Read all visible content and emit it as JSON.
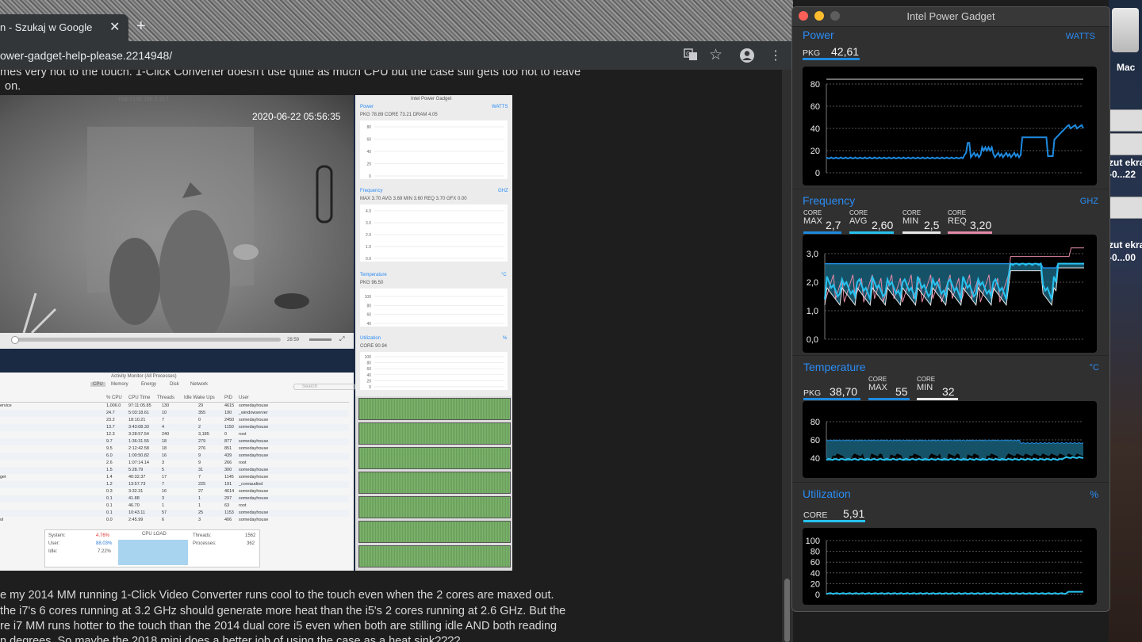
{
  "browser": {
    "tab_title": "n - Szukaj w Google",
    "tab_close": "✕",
    "new_tab": "+",
    "url": "ower-gadget-help-please.2214948/"
  },
  "page": {
    "lines_top": [
      "mes very hot to the touch. 1-Click Converter doesn't use quite as much CPU but the case still gets too hot to leave",
      "on."
    ],
    "lines_bottom": [
      "e my 2014 MM running 1-Click Video Converter runs cool to the touch even when the 2 cores are maxed out.",
      "the i7's 6 cores running at 3.2 GHz should generate more heat than the i5's 2 cores running at 2.6 GHz. But the",
      "re i7 MM runs hotter to the touch than the 2014 dual core i5 even when both are stilling idle AND both reading",
      "n degrees. So maybe the 2018 mini does a better job of using the case as a heat sink????"
    ],
    "camera": {
      "url": "rtsp://192.168.0.217",
      "timestamp": "2020-06-22 05:56:35",
      "time": "28:59"
    },
    "activity_monitor": {
      "title": "Activity Monitor (All Processes)",
      "tabs": [
        "CPU",
        "Memory",
        "Energy",
        "Disk",
        "Network"
      ],
      "search": "Search",
      "columns": [
        "% CPU",
        "CPU Time",
        "Threads",
        "Idle Wake Ups",
        "PID",
        "User"
      ],
      "rows": [
        [
          "ervice",
          "1,006.0",
          "97:11:05.85",
          "130",
          "29",
          "4615",
          "somedayhouse"
        ],
        [
          "",
          "24.7",
          "5:03:18.61",
          "10",
          "355",
          "190",
          "_windowserver"
        ],
        [
          "",
          "23.2",
          "18:10.21",
          "7",
          "0",
          "2450",
          "somedayhouse"
        ],
        [
          "",
          "13.7",
          "3:43:08.33",
          "4",
          "2",
          "1150",
          "somedayhouse"
        ],
        [
          "",
          "12.3",
          "3:28:57.54",
          "240",
          "3,185",
          "0",
          "root"
        ],
        [
          "",
          "9.7",
          "1:36:31.55",
          "18",
          "279",
          "877",
          "somedayhouse"
        ],
        [
          "",
          "9.5",
          "2:12:42.58",
          "18",
          "276",
          "851",
          "somedayhouse"
        ],
        [
          "",
          "6.0",
          "1:00:50.82",
          "16",
          "9",
          "439",
          "somedayhouse"
        ],
        [
          "",
          "2.6",
          "1:07:14.14",
          "3",
          "9",
          "266",
          "root"
        ],
        [
          "",
          "1.5",
          "5:28.79",
          "5",
          "31",
          "300",
          "somedayhouse"
        ],
        [
          "get",
          "1.4",
          "40:32.37",
          "17",
          "7",
          "1145",
          "somedayhouse"
        ],
        [
          "",
          "1.2",
          "13:57.73",
          "7",
          "225",
          "191",
          "_coreaudiod"
        ],
        [
          "",
          "0.3",
          "3:32.31",
          "16",
          "27",
          "4614",
          "somedayhouse"
        ],
        [
          "",
          "0.1",
          "41.88",
          "3",
          "1",
          "297",
          "somedayhouse"
        ],
        [
          "",
          "0.1",
          "46.70",
          "1",
          "1",
          "63",
          "root"
        ],
        [
          "",
          "0.1",
          "10:43.11",
          "57",
          "25",
          "1153",
          "somedayhouse"
        ],
        [
          "ol",
          "0.0",
          "2:45.99",
          "6",
          "3",
          "406",
          "somedayhouse"
        ]
      ],
      "summary": {
        "system_label": "System:",
        "system": "4.76%",
        "user_label": "User:",
        "user": "88.03%",
        "idle_label": "Idle:",
        "idle": "7.22%",
        "cpu_load": "CPU LOAD",
        "threads_label": "Threads:",
        "threads": "1562",
        "processes_label": "Processes:",
        "processes": "362"
      }
    },
    "mini_ipg": {
      "title": "Intel Power Gadget",
      "power_title": "Power",
      "power_unit": "WATTS",
      "power_metrics": "PKG  78.89   CORE  73.21   DRAM  4.05",
      "power_ticks": [
        "80",
        "60",
        "40",
        "20",
        "0"
      ],
      "freq_title": "Frequency",
      "freq_unit": "GHZ",
      "freq_metrics": "MAX 3.70  AVG 3.69  MIN 3.60  REQ 3.70  GFX 0.00",
      "freq_ticks": [
        "4.0",
        "3.0",
        "2.0",
        "1.0",
        "0.0"
      ],
      "temp_title": "Temperature",
      "temp_unit": "°C",
      "temp_metrics": "PKG  96.50",
      "temp_ticks": [
        "100",
        "80",
        "60",
        "40"
      ],
      "util_title": "Utilization",
      "util_unit": "%",
      "util_metrics": "CORE  90.94",
      "util_ticks": [
        "100",
        "80",
        "60",
        "40",
        "20",
        "0"
      ]
    }
  },
  "desktop": {
    "label_mac": "Mac",
    "shot1_a": "zut ekra",
    "shot1_b": "-0...22",
    "shot2_a": "zut ekra",
    "shot2_b": "-0...00"
  },
  "ipg": {
    "title": "Intel Power Gadget",
    "colors": {
      "accent": "#2a8cf5",
      "series_blue": "#1e8ae0",
      "series_cyan": "#27c2f0",
      "series_white": "#e8e8e8",
      "series_pink": "#e48aa8",
      "grid": "#555555",
      "bg": "#303030"
    },
    "power": {
      "title": "Power",
      "unit": "WATTS",
      "pkg_label": "PKG",
      "pkg_value": "42,61",
      "ticks": [
        "80",
        "60",
        "40",
        "20",
        "0"
      ]
    },
    "frequency": {
      "title": "Frequency",
      "unit": "GHZ",
      "metrics": [
        {
          "top": "CORE",
          "label": "MAX",
          "value": "2,7",
          "color": "#1e8ae0"
        },
        {
          "top": "CORE",
          "label": "AVG",
          "value": "2,60",
          "color": "#27c2f0"
        },
        {
          "top": "CORE",
          "label": "MIN",
          "value": "2,5",
          "color": "#e8e8e8"
        },
        {
          "top": "CORE",
          "label": "REQ",
          "value": "3,20",
          "color": "#e48aa8"
        }
      ],
      "ticks": [
        "3,0",
        "2,0",
        "1,0",
        "0,0"
      ]
    },
    "temperature": {
      "title": "Temperature",
      "unit": "°C",
      "pkg_label": "PKG",
      "pkg_value": "38,70",
      "max_top": "CORE",
      "max_label": "MAX",
      "max_value": "55",
      "min_top": "CORE",
      "min_label": "MIN",
      "min_value": "32",
      "ticks": [
        "80",
        "60",
        "40"
      ]
    },
    "utilization": {
      "title": "Utilization",
      "unit": "%",
      "core_label": "CORE",
      "core_value": "5,91",
      "ticks": [
        "100",
        "80",
        "60",
        "40",
        "20",
        "0"
      ]
    }
  }
}
